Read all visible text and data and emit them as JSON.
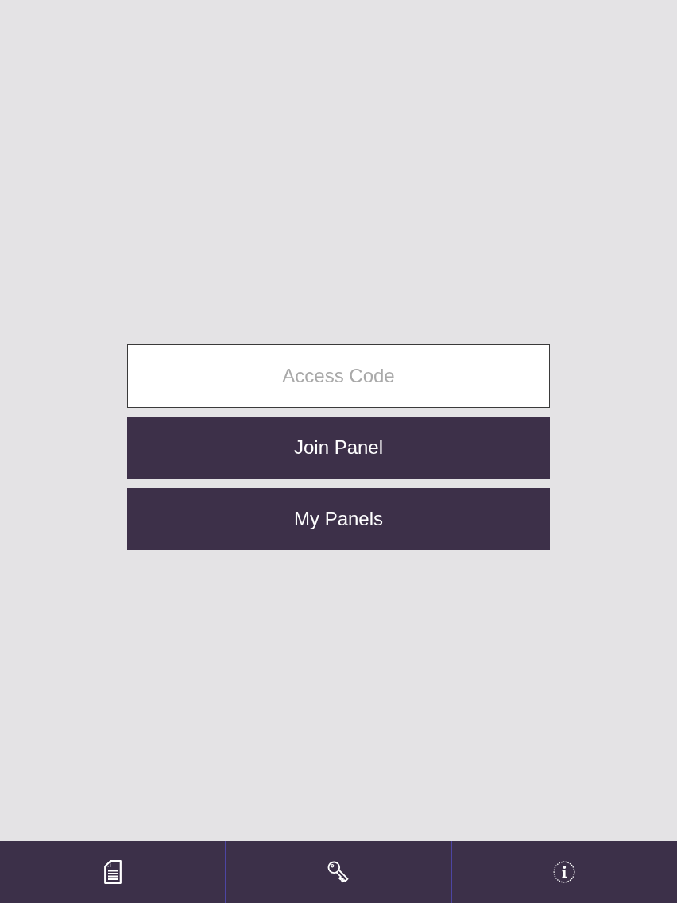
{
  "access_code_field": {
    "placeholder": "Access Code"
  },
  "buttons": [
    {
      "label": "Join Panel"
    },
    {
      "label": "My Panels"
    }
  ]
}
